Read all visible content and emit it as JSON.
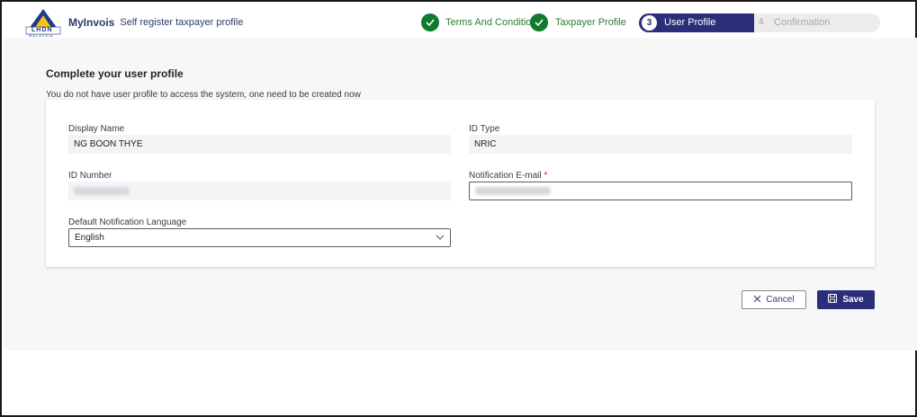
{
  "header": {
    "app_name": "MyInvois",
    "app_subtitle": "Self register taxpayer profile",
    "logo_text": "LHDN",
    "logo_subtext": "MALAYSIA"
  },
  "steps": [
    {
      "label": "Terms And Conditions",
      "status": "done"
    },
    {
      "label": "Taxpayer Profile",
      "status": "done"
    },
    {
      "number": "3",
      "label": "User Profile",
      "status": "active"
    },
    {
      "number": "4",
      "label": "Confirmation",
      "status": "pending"
    }
  ],
  "page": {
    "title": "Complete your user profile",
    "subtitle": "You do not have user profile to access the system, one need to be created now"
  },
  "form": {
    "display_name_label": "Display Name",
    "display_name_value": "NG BOON THYE",
    "id_type_label": "ID Type",
    "id_type_value": "NRIC",
    "id_number_label": "ID Number",
    "email_label": "Notification E-mail",
    "required_marker": "*",
    "language_label": "Default Notification Language",
    "language_value": "English"
  },
  "actions": {
    "cancel_label": "Cancel",
    "save_label": "Save"
  },
  "colors": {
    "primary": "#2b2f7a",
    "success": "#0f7b2e",
    "background": "#f7f7f8"
  }
}
